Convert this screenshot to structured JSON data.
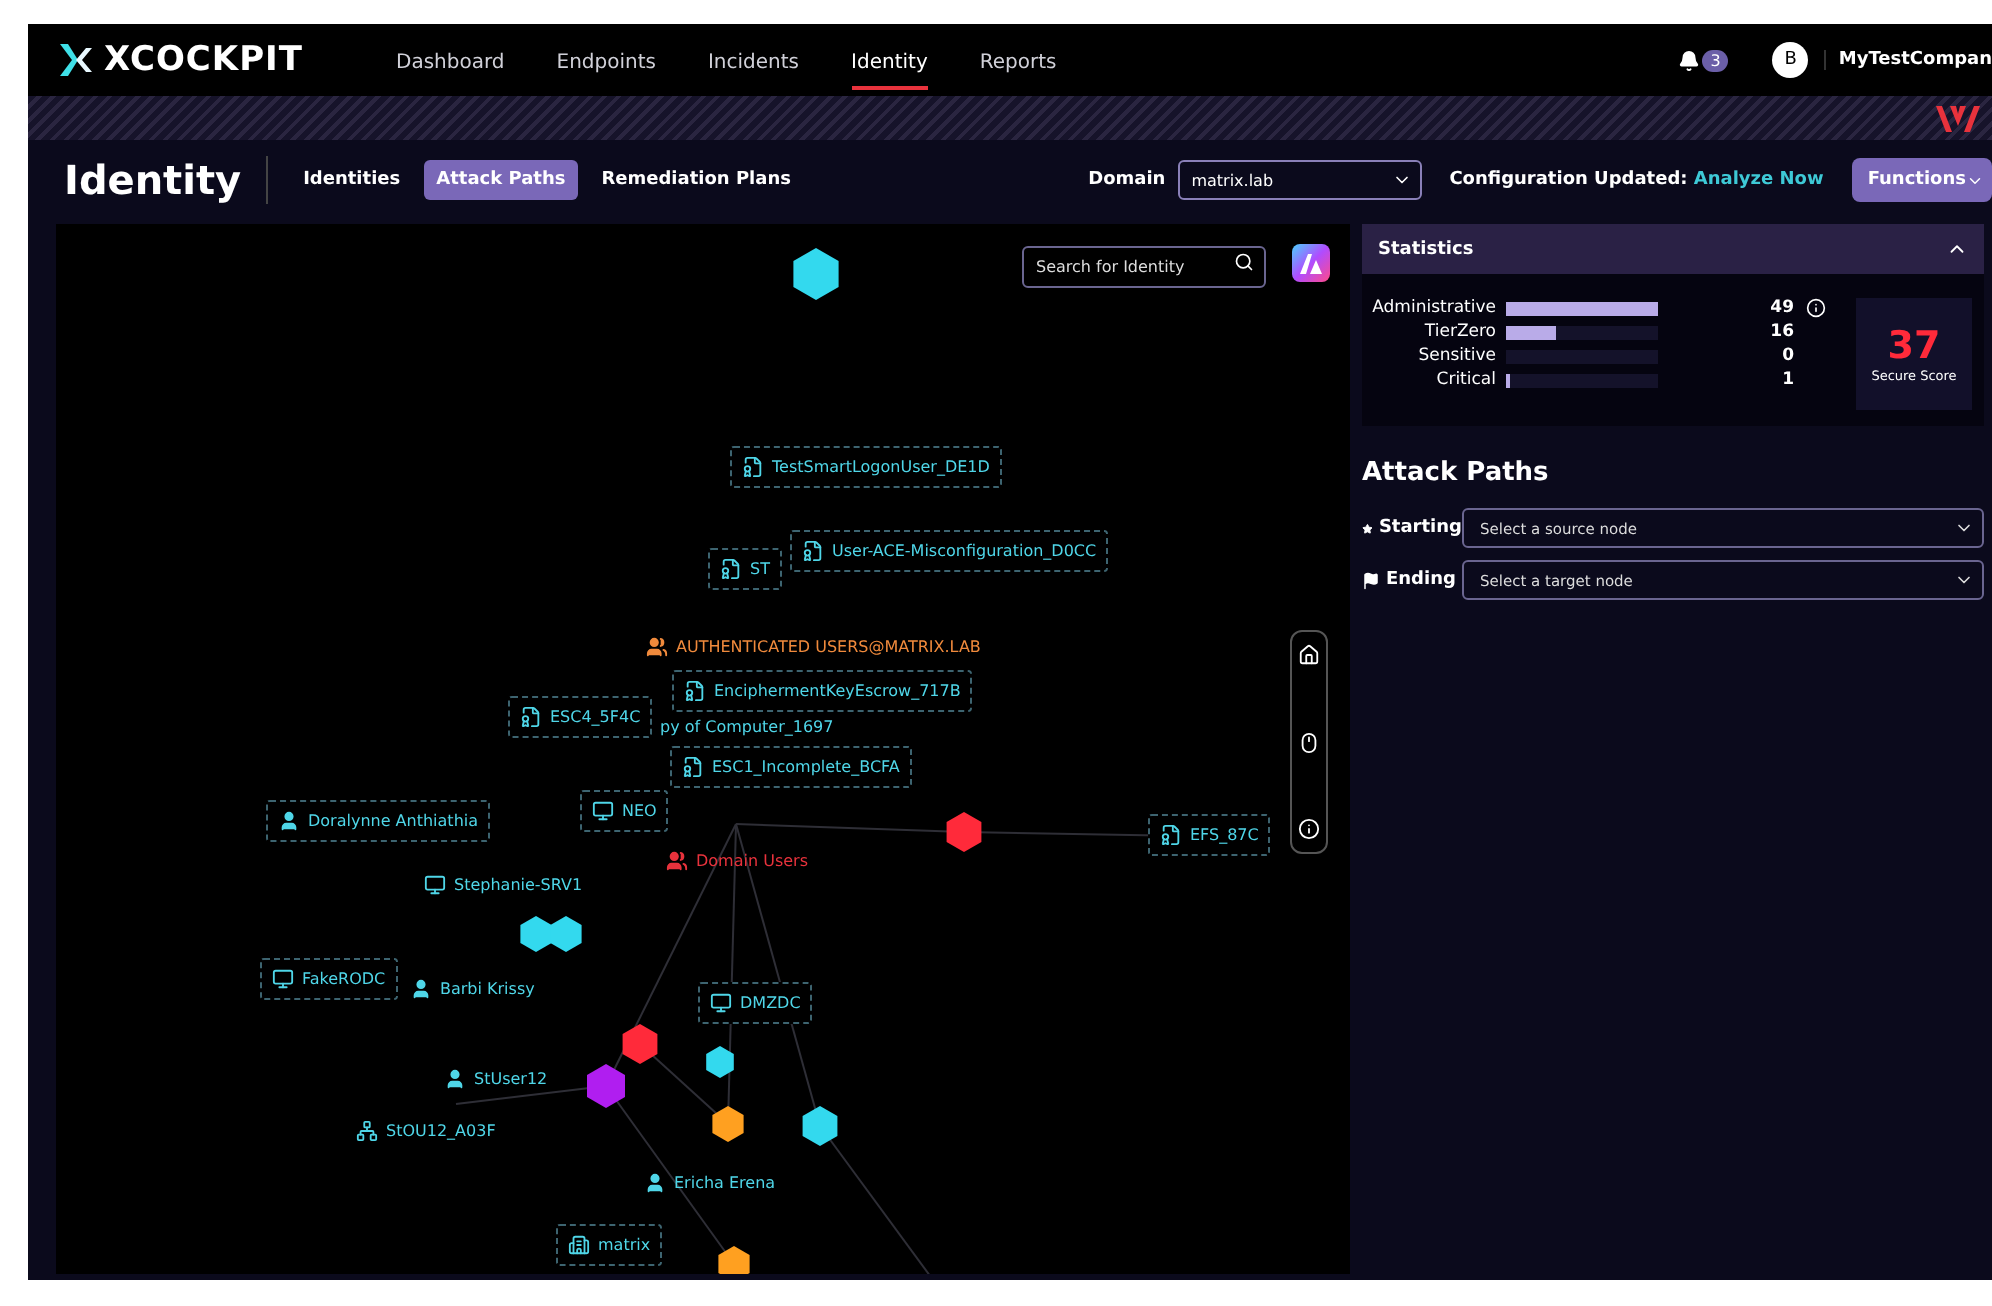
{
  "brand": "XCOCKPIT",
  "nav": [
    {
      "label": "Dashboard",
      "selected": false
    },
    {
      "label": "Endpoints",
      "selected": false
    },
    {
      "label": "Incidents",
      "selected": false
    },
    {
      "label": "Identity",
      "selected": true
    },
    {
      "label": "Reports",
      "selected": false
    }
  ],
  "notifications": "3",
  "avatar": "B",
  "company": "MyTestCompan",
  "page_title": "Identity",
  "tabs": [
    {
      "label": "Identities",
      "selected": false
    },
    {
      "label": "Attack Paths",
      "selected": true
    },
    {
      "label": "Remediation Plans",
      "selected": false
    }
  ],
  "domain": {
    "label": "Domain",
    "value": "matrix.lab"
  },
  "config": {
    "label": "Configuration Updated:",
    "link": "Analyze Now"
  },
  "functions_button": "Functions",
  "search": {
    "placeholder": "Search for Identity"
  },
  "graph_nodes": [
    {
      "label": "TestSmartLogonUser_DE1D",
      "kind": "certificate",
      "boxed": true,
      "color": "#4fd6e8"
    },
    {
      "label": "User-ACE-Misconfiguration_D0CC",
      "kind": "certificate",
      "boxed": true,
      "color": "#4fd6e8"
    },
    {
      "label": "ST",
      "kind": "certificate",
      "boxed": true,
      "color": "#4fd6e8"
    },
    {
      "label": "AUTHENTICATED USERS@MATRIX.LAB",
      "kind": "group",
      "boxed": false,
      "color": "#f08a3c"
    },
    {
      "label": "EnciphermentKeyEscrow_717B",
      "kind": "certificate",
      "boxed": true,
      "color": "#4fd6e8"
    },
    {
      "label": "py of Computer_1697",
      "kind": "none",
      "boxed": false,
      "color": "#4fd6e8"
    },
    {
      "label": "ESC4_5F4C",
      "kind": "certificate",
      "boxed": true,
      "color": "#4fd6e8"
    },
    {
      "label": "ESC1_Incomplete_BCFA",
      "kind": "certificate",
      "boxed": true,
      "color": "#4fd6e8"
    },
    {
      "label": "NEO",
      "kind": "computer",
      "boxed": true,
      "color": "#4fd6e8"
    },
    {
      "label": "Doralynne Anthiathia",
      "kind": "user",
      "boxed": true,
      "color": "#4fd6e8"
    },
    {
      "label": "Domain Users",
      "kind": "group",
      "boxed": false,
      "color": "#e8323c"
    },
    {
      "label": "EFS_87C",
      "kind": "certificate",
      "boxed": true,
      "color": "#4fd6e8"
    },
    {
      "label": "Stephanie-SRV1",
      "kind": "computer",
      "boxed": false,
      "color": "#4fd6e8"
    },
    {
      "label": "FakeRODC",
      "kind": "computer",
      "boxed": true,
      "color": "#4fd6e8"
    },
    {
      "label": "Barbi Krissy",
      "kind": "user",
      "boxed": false,
      "color": "#4fd6e8"
    },
    {
      "label": "DMZDC",
      "kind": "computer",
      "boxed": true,
      "color": "#4fd6e8"
    },
    {
      "label": "StUser12",
      "kind": "user",
      "boxed": false,
      "color": "#4fd6e8"
    },
    {
      "label": "StOU12_A03F",
      "kind": "ou",
      "boxed": false,
      "color": "#4fd6e8"
    },
    {
      "label": "Ericha Erena",
      "kind": "user",
      "boxed": false,
      "color": "#4fd6e8"
    },
    {
      "label": "matrix",
      "kind": "domain",
      "boxed": true,
      "color": "#4fd6e8"
    }
  ],
  "statistics": {
    "title": "Statistics",
    "expanded": true,
    "rows": [
      {
        "label": "Administrative",
        "value": "49",
        "level": 1
      },
      {
        "label": "TierZero",
        "value": "16",
        "level": 0.33
      },
      {
        "label": "Sensitive",
        "value": "0"
      },
      {
        "label": "Critical",
        "value": "1",
        "level": 0.02
      }
    ],
    "score": "37",
    "score_label": "Secure Score"
  },
  "attack_paths": {
    "title": "Attack Paths",
    "selectors": [
      {
        "label": "Starting",
        "kind": "start",
        "placeholder": "Select a source node"
      },
      {
        "label": "Ending",
        "kind": "end",
        "placeholder": "Select a target node"
      }
    ]
  }
}
